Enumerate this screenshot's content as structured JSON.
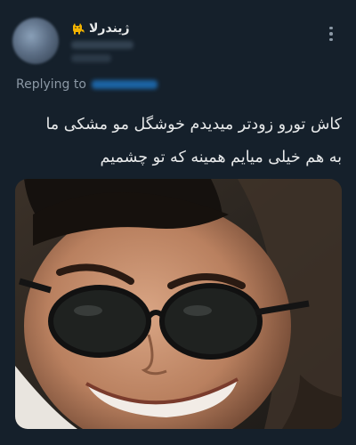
{
  "tweet": {
    "author": {
      "display_name": "ژیندرلا",
      "badge_icon": "cat-icon",
      "badge_color": "#f4b400"
    },
    "reply": {
      "label": "Replying to"
    },
    "text_lines": [
      "کاش تورو زودتر میدیدم خوشگل مو مشکی ما",
      "به هم خیلی میایم همینه که تو چشمیم"
    ],
    "media": {
      "kind": "photo",
      "subject": "smiling person wearing dark sunglasses"
    },
    "more_icon": "more-vertical-icon"
  },
  "colors": {
    "background": "#15202b",
    "text_primary": "#e7e9ea",
    "text_secondary": "#8b98a5",
    "link": "#1d9bf0"
  }
}
